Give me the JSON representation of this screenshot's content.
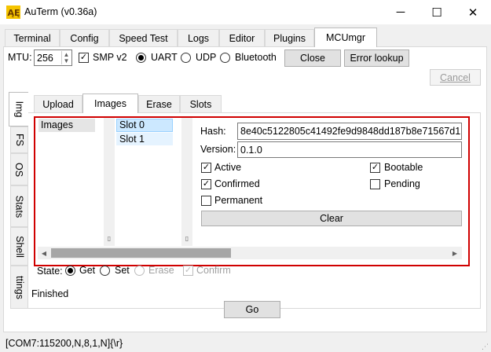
{
  "window": {
    "title": "AuTerm (v0.36a)",
    "minimize": "─",
    "maximize": "☐",
    "close": "✕"
  },
  "tabs": [
    {
      "label": "Terminal"
    },
    {
      "label": "Config"
    },
    {
      "label": "Speed Test"
    },
    {
      "label": "Logs"
    },
    {
      "label": "Editor"
    },
    {
      "label": "Plugins"
    },
    {
      "label": "MCUmgr"
    }
  ],
  "connection": {
    "mtu_label": "MTU:",
    "mtu_value": "256",
    "smp_v2_label": "SMP v2",
    "smp_v2_checked": true,
    "transport": [
      "UART",
      "UDP",
      "Bluetooth"
    ],
    "transport_selected": "UART",
    "close_label": "Close",
    "error_lookup_label": "Error lookup",
    "cancel_label": "Cancel"
  },
  "side_tabs": [
    {
      "label": "Img"
    },
    {
      "label": "FS"
    },
    {
      "label": "OS"
    },
    {
      "label": "Stats"
    },
    {
      "label": "Shell"
    },
    {
      "label": "ttings"
    }
  ],
  "sub_tabs": [
    {
      "label": "Upload"
    },
    {
      "label": "Images"
    },
    {
      "label": "Erase"
    },
    {
      "label": "Slots"
    }
  ],
  "images_panel": {
    "tree_root": "Images",
    "slots": [
      "Slot 0",
      "Slot 1"
    ],
    "selected_slot": "Slot 0",
    "hash_label": "Hash:",
    "hash_value": "8e40c5122805c41492fe9d9848dd187b8e71567d1",
    "version_label": "Version:",
    "version_value": "0.1.0",
    "flags": {
      "active": {
        "label": "Active",
        "checked": true
      },
      "bootable": {
        "label": "Bootable",
        "checked": true
      },
      "confirmed": {
        "label": "Confirmed",
        "checked": true
      },
      "pending": {
        "label": "Pending",
        "checked": false
      },
      "permanent": {
        "label": "Permanent",
        "checked": false
      }
    },
    "erase_button_label": "Clear"
  },
  "state": {
    "label": "State:",
    "options": [
      "Get",
      "Set",
      "Erase"
    ],
    "selected": "Get",
    "confirm_label": "Confirm",
    "confirm_checked": true
  },
  "status_text": "Finished",
  "go_label": "Go",
  "statusbar": {
    "text": "[COM7:115200,N,8,1,N]{\\r}"
  },
  "colors": {
    "highlight_box": "#d00000",
    "selection": "#cce8ff",
    "tree_selection": "#e5e5e5"
  }
}
